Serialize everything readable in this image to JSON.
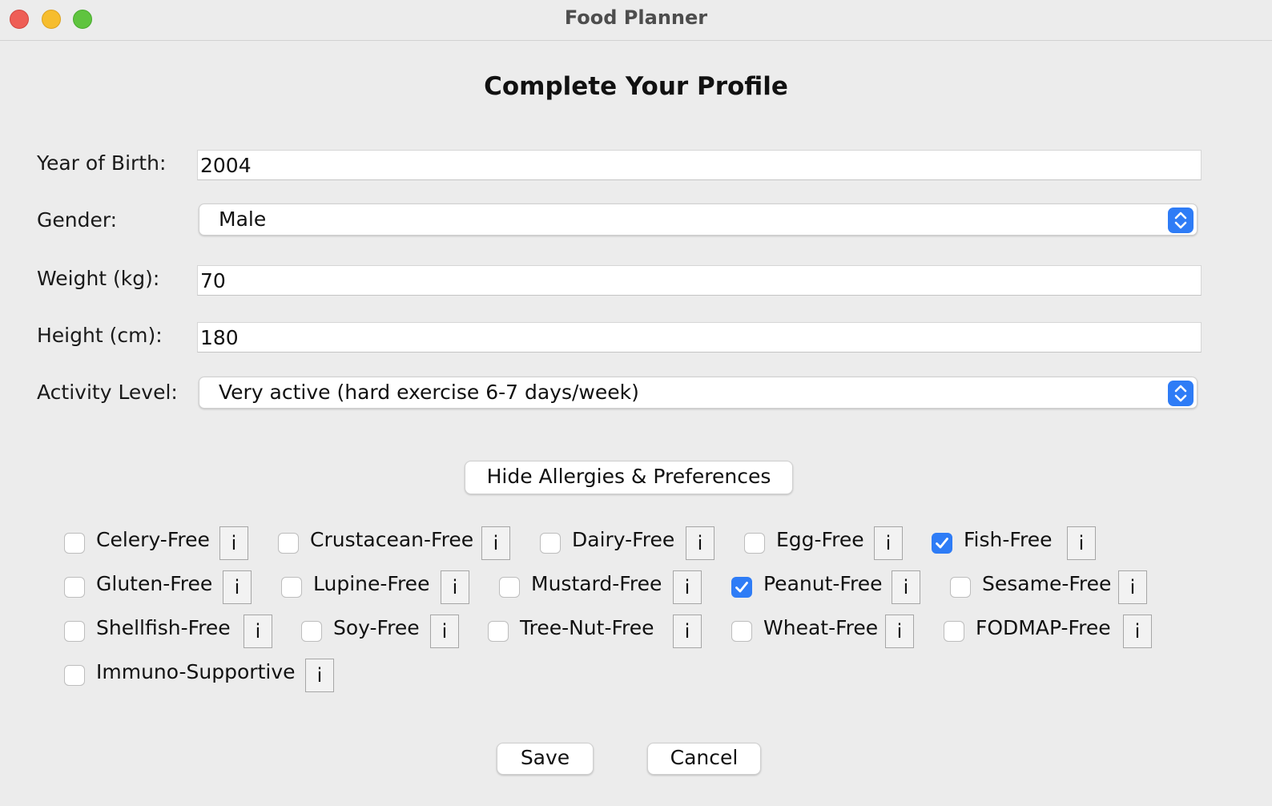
{
  "window": {
    "title": "Food Planner"
  },
  "heading": "Complete Your Profile",
  "form": {
    "year_of_birth": {
      "label": "Year of Birth:",
      "value": "2004"
    },
    "gender": {
      "label": "Gender:",
      "value": "Male"
    },
    "weight": {
      "label": "Weight (kg):",
      "value": "70"
    },
    "height": {
      "label": "Height (cm):",
      "value": "180"
    },
    "activity": {
      "label": "Activity Level:",
      "value": "Very active (hard exercise 6-7 days/week)"
    }
  },
  "toggle_label": "Hide Allergies & Preferences",
  "info_label": "i",
  "allergies": [
    {
      "label": "Celery-Free",
      "checked": false
    },
    {
      "label": "Crustacean-Free",
      "checked": false
    },
    {
      "label": "Dairy-Free",
      "checked": false
    },
    {
      "label": "Egg-Free",
      "checked": false
    },
    {
      "label": "Fish-Free",
      "checked": true
    },
    {
      "label": "Gluten-Free",
      "checked": false
    },
    {
      "label": "Lupine-Free",
      "checked": false
    },
    {
      "label": "Mustard-Free",
      "checked": false
    },
    {
      "label": "Peanut-Free",
      "checked": true
    },
    {
      "label": "Sesame-Free",
      "checked": false
    },
    {
      "label": "Shellfish-Free",
      "checked": false
    },
    {
      "label": "Soy-Free",
      "checked": false
    },
    {
      "label": "Tree-Nut-Free",
      "checked": false
    },
    {
      "label": "Wheat-Free",
      "checked": false
    },
    {
      "label": "FODMAP-Free",
      "checked": false
    },
    {
      "label": "Immuno-Supportive",
      "checked": false
    }
  ],
  "actions": {
    "save_label": "Save",
    "cancel_label": "Cancel"
  },
  "colors": {
    "accent": "#2e7cf6",
    "window_bg": "#ececec"
  }
}
